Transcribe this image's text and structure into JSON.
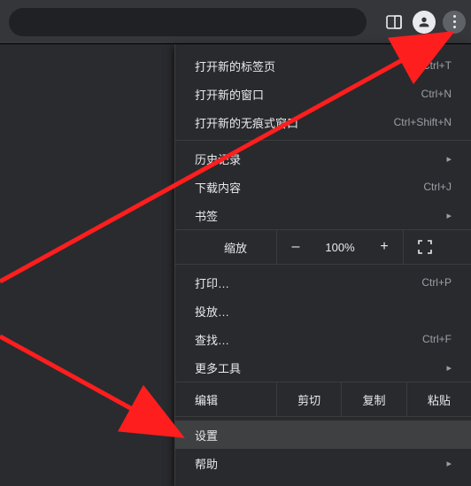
{
  "toolbar": {
    "reader_icon": "reader-mode",
    "profile_icon": "profile",
    "menu_icon": "more-vert"
  },
  "menu": {
    "new_tab": {
      "label": "打开新的标签页",
      "accel": "Ctrl+T"
    },
    "new_window": {
      "label": "打开新的窗口",
      "accel": "Ctrl+N"
    },
    "new_incognito": {
      "label": "打开新的无痕式窗口",
      "accel": "Ctrl+Shift+N"
    },
    "history": {
      "label": "历史记录"
    },
    "downloads": {
      "label": "下载内容",
      "accel": "Ctrl+J"
    },
    "bookmarks": {
      "label": "书签"
    },
    "zoom": {
      "label": "缩放",
      "minus": "–",
      "value": "100%",
      "plus": "+"
    },
    "print": {
      "label": "打印…",
      "accel": "Ctrl+P"
    },
    "cast": {
      "label": "投放…"
    },
    "find": {
      "label": "查找…",
      "accel": "Ctrl+F"
    },
    "more_tools": {
      "label": "更多工具"
    },
    "edit": {
      "label": "编辑",
      "cut": "剪切",
      "copy": "复制",
      "paste": "粘贴"
    },
    "settings": {
      "label": "设置"
    },
    "help": {
      "label": "帮助"
    }
  }
}
